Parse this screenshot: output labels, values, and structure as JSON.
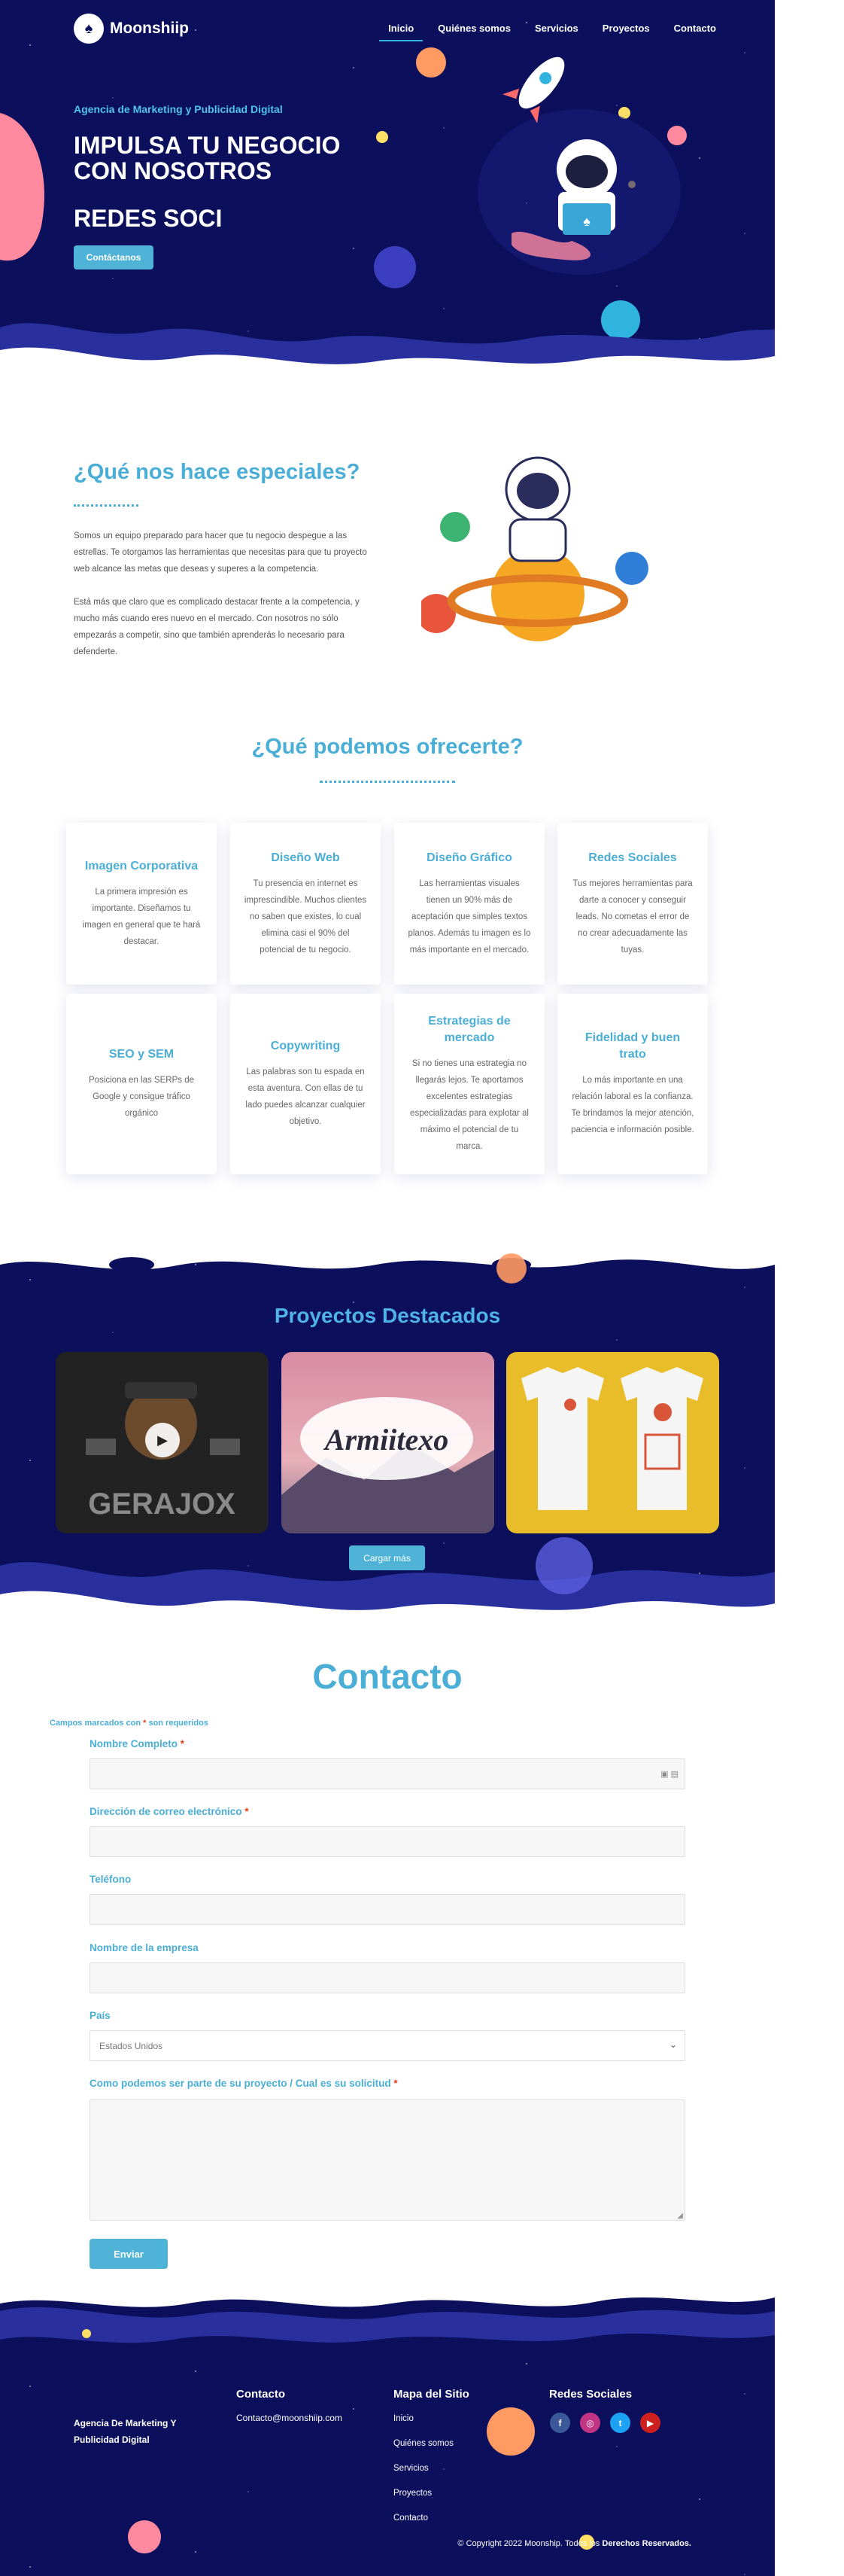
{
  "brand": {
    "name": "Moonshiip"
  },
  "nav": {
    "items": [
      "Inicio",
      "Quiénes somos",
      "Servicios",
      "Proyectos",
      "Contacto"
    ],
    "active": "Inicio"
  },
  "hero": {
    "kicker": "Agencia de Marketing y Publicidad Digital",
    "title": "IMPULSA TU NEGOCIO CON NOSOTROS",
    "rotating_text": "REDES SOCI",
    "button": "Contáctanos"
  },
  "special": {
    "heading": "¿Qué nos hace especiales?",
    "p1": "Somos un equipo preparado para hacer que tu negocio despegue a las estrellas. Te otorgamos las herramientas que necesitas para que tu proyecto web alcance las metas que deseas y superes a la competencia.",
    "p2": "Está más que claro que es complicado destacar frente a la competencia, y mucho más cuando eres nuevo en el mercado. Con nosotros no sólo empezarás a competir, sino que también aprenderás lo necesario para defenderte."
  },
  "offer": {
    "heading": "¿Qué podemos ofrecerte?",
    "cards": [
      {
        "title": "Imagen Corporativa",
        "text": "La primera impresión es importante. Diseñamos tu imagen en general que te hará destacar."
      },
      {
        "title": "Diseño Web",
        "text": "Tu presencia en internet es imprescindible. Muchos clientes no saben que existes, lo cual elimina casi el 90% del potencial de tu negocio."
      },
      {
        "title": "Diseño Gráfico",
        "text": "Las herramientas visuales tienen un 90% más de aceptación que simples textos planos. Además tu imagen es lo más importante en el mercado."
      },
      {
        "title": "Redes Sociales",
        "text": "Tus mejores herramientas para darte a conocer y conseguir leads. No cometas el error de no crear adecuadamente las tuyas."
      },
      {
        "title": "SEO y SEM",
        "text": "Posiciona en las SERPs de Google y consigue tráfico orgánico"
      },
      {
        "title": "Copywriting",
        "text": "Las palabras son tu espada en esta aventura. Con ellas de tu lado puedes alcanzar cualquier objetivo."
      },
      {
        "title": "Estrategias de mercado",
        "text": "Si no tienes una estrategia no llegarás lejos. Te aportamos excelentes estrategias especializadas para explotar al máximo el potencial de tu marca."
      },
      {
        "title": "Fidelidad y buen trato",
        "text": "Lo más importante en una relación laboral es la confianza. Te brindamos la mejor atención, paciencia e información posible."
      }
    ]
  },
  "projects": {
    "heading": "Proyectos Destacados",
    "items": [
      {
        "label": "GERAJOX",
        "kind": "video"
      },
      {
        "label": "Armiitexo",
        "kind": "image"
      },
      {
        "label": "",
        "kind": "image"
      }
    ],
    "more_button": "Cargar más"
  },
  "contact": {
    "heading": "Contacto",
    "required_note_prefix": "Campos marcados con",
    "required_star": "*",
    "required_note_suffix": "son requeridos",
    "fields": [
      {
        "label": "Nombre Completo",
        "required": true,
        "value": ""
      },
      {
        "label": "Dirección de correo electrónico",
        "required": true,
        "value": ""
      },
      {
        "label": "Teléfono",
        "required": false,
        "value": ""
      },
      {
        "label": "Nombre de la empresa",
        "required": false,
        "value": ""
      },
      {
        "label": "País",
        "required": false,
        "value": "Estados Unidos"
      },
      {
        "label": "Como podemos ser parte de su proyecto / Cual es su solicitud",
        "required": true,
        "value": ""
      }
    ],
    "submit": "Enviar"
  },
  "footer": {
    "agency": "Agencia De Marketing Y Publicidad Digital",
    "contact_heading": "Contacto",
    "email": "Contacto@moonshiip.com",
    "sitemap_heading": "Mapa del Sitio",
    "sitemap": [
      "Inicio",
      "Quiénes somos",
      "Servicios",
      "Proyectos",
      "Contacto"
    ],
    "social_heading": "Redes Sociales",
    "social": [
      {
        "name": "facebook-icon",
        "glyph": "f",
        "color": "#3b5998"
      },
      {
        "name": "instagram-icon",
        "glyph": "◎",
        "color": "#c13584"
      },
      {
        "name": "twitter-icon",
        "glyph": "t",
        "color": "#1da1f2"
      },
      {
        "name": "youtube-icon",
        "glyph": "▶",
        "color": "#cd201f"
      }
    ],
    "copyright_prefix": "© Copyright 2022 Moonship. Todos los",
    "copyright_bold": "Derechos Reservados."
  },
  "colors": {
    "navy": "#0c0f5c",
    "accent": "#4aaed6",
    "button": "#4fb3d8",
    "required": "#e2401c"
  }
}
